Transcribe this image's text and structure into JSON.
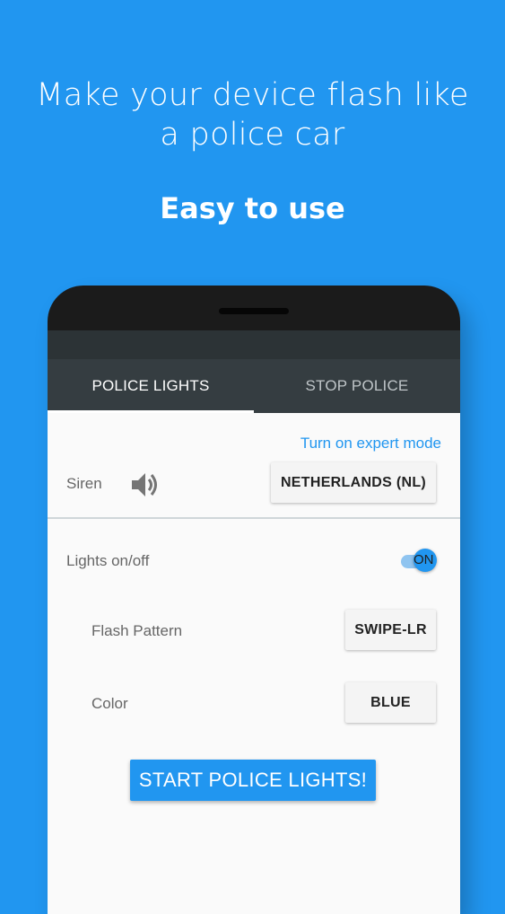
{
  "promo": {
    "headline": "Make your device flash like a police car",
    "subheadline": "Easy to use"
  },
  "tabs": [
    {
      "label": "POLICE LIGHTS",
      "active": true
    },
    {
      "label": "STOP POLICE",
      "active": false
    }
  ],
  "expert_mode_link": "Turn on expert mode",
  "siren": {
    "label": "Siren",
    "icon": "speaker-icon",
    "country_button": "NETHERLANDS (NL)"
  },
  "lights": {
    "label": "Lights on/off",
    "toggle_text": "ON",
    "toggle_on": true
  },
  "flash_pattern": {
    "label": "Flash Pattern",
    "value": "SWIPE-LR"
  },
  "color": {
    "label": "Color",
    "value": "BLUE"
  },
  "start_button": "START POLICE LIGHTS!",
  "colors": {
    "background": "#2196f0",
    "accent": "#2196f0",
    "tabbar": "#353d41"
  }
}
